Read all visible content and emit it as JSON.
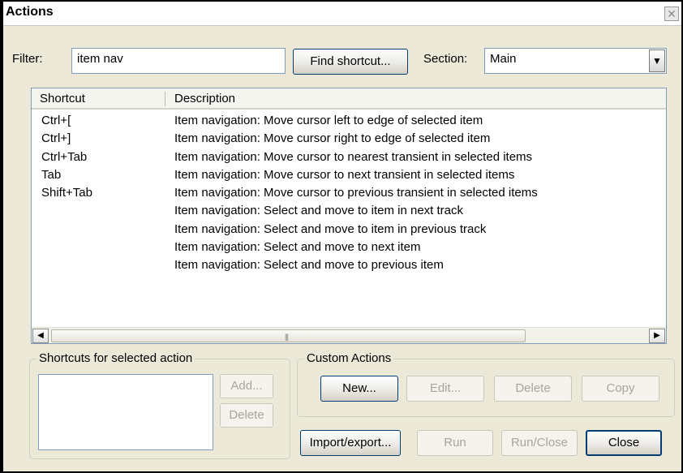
{
  "window": {
    "title": "Actions",
    "close_icon": "close-icon"
  },
  "filter": {
    "label": "Filter:",
    "value": "item nav"
  },
  "find_shortcut_label": "Find shortcut...",
  "section": {
    "label": "Section:",
    "value": "Main"
  },
  "list": {
    "headers": {
      "shortcut": "Shortcut",
      "description": "Description"
    },
    "rows": [
      {
        "shortcut": "Ctrl+[",
        "description": "Item navigation: Move cursor left to edge of selected item"
      },
      {
        "shortcut": "Ctrl+]",
        "description": "Item navigation: Move cursor right to edge of selected item"
      },
      {
        "shortcut": "Ctrl+Tab",
        "description": "Item navigation: Move cursor to nearest transient in selected items"
      },
      {
        "shortcut": "Tab",
        "description": "Item navigation: Move cursor to next transient in selected items"
      },
      {
        "shortcut": "Shift+Tab",
        "description": "Item navigation: Move cursor to previous transient in selected items"
      },
      {
        "shortcut": "",
        "description": "Item navigation: Select and move to item in next track"
      },
      {
        "shortcut": "",
        "description": "Item navigation: Select and move to item in previous track"
      },
      {
        "shortcut": "",
        "description": "Item navigation: Select and move to next item"
      },
      {
        "shortcut": "",
        "description": "Item navigation: Select and move to previous item"
      }
    ],
    "scroll_left_icon": "arrow-left-icon",
    "scroll_right_icon": "arrow-right-icon"
  },
  "shortcuts_group": {
    "title": "Shortcuts for selected action",
    "add_label": "Add...",
    "delete_label": "Delete"
  },
  "custom_group": {
    "title": "Custom Actions",
    "new_label": "New...",
    "edit_label": "Edit...",
    "delete_label": "Delete",
    "copy_label": "Copy"
  },
  "bottom": {
    "import_export_label": "Import/export...",
    "run_label": "Run",
    "run_close_label": "Run/Close",
    "close_label": "Close"
  }
}
